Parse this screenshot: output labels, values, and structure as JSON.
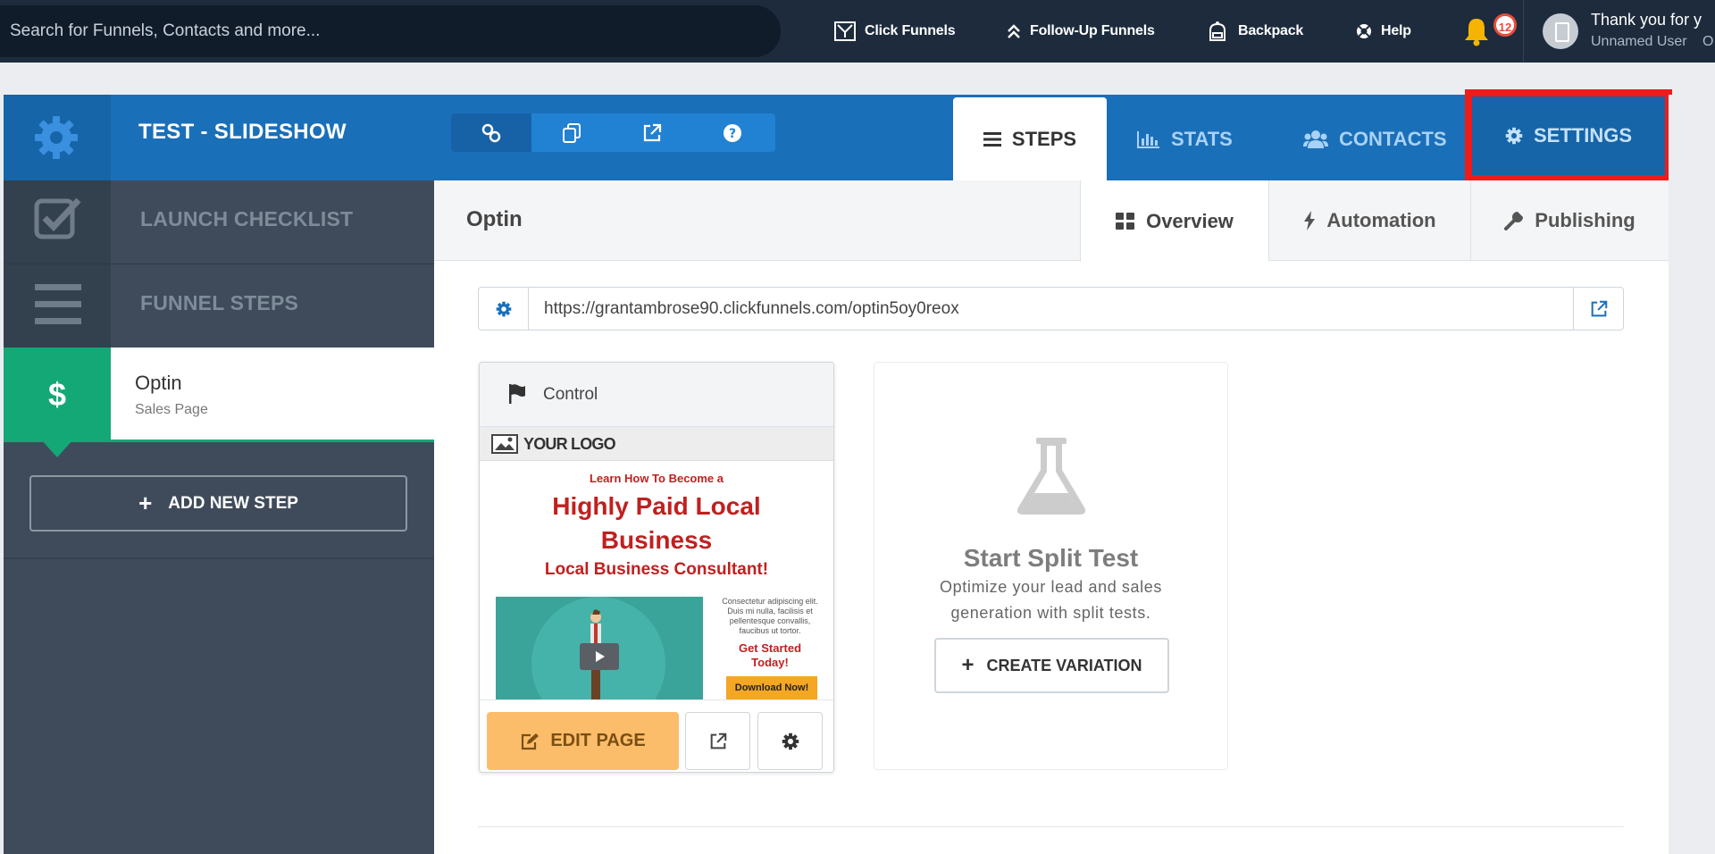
{
  "topbar": {
    "search_placeholder": "Search for Funnels, Contacts and more...",
    "nav": [
      {
        "label": "Click Funnels",
        "icon": "clickfunnels-icon"
      },
      {
        "label": "Follow-Up Funnels",
        "icon": "chevrons-up-icon"
      },
      {
        "label": "Backpack",
        "icon": "backpack-icon"
      },
      {
        "label": "Help",
        "icon": "lifebuoy-icon"
      }
    ],
    "notification_count": "12",
    "user_greeting": "Thank you for y",
    "user_name": "Unnamed User",
    "user_extra": "O"
  },
  "funnel": {
    "title": "TEST - SLIDESHOW",
    "tools": [
      "link-icon",
      "copy-icon",
      "external-link-icon",
      "question-icon"
    ],
    "tabs": {
      "steps": "STEPS",
      "stats": "STATS",
      "contacts": "CONTACTS",
      "settings": "SETTINGS"
    }
  },
  "sidebar": {
    "launch_checklist": "LAUNCH CHECKLIST",
    "funnel_steps": "FUNNEL STEPS",
    "active_step": {
      "symbol": "$",
      "name": "Optin",
      "type": "Sales Page"
    },
    "add_step": "ADD NEW STEP"
  },
  "step_panel": {
    "title": "Optin",
    "subtabs": {
      "overview": "Overview",
      "automation": "Automation",
      "publishing": "Publishing"
    },
    "url": "https://grantambrose90.clickfunnels.com/optin5oy0reox"
  },
  "control_card": {
    "label": "Control",
    "preview": {
      "logo": "YOUR LOGO",
      "kicker": "Learn How To Become a",
      "headline": "Highly Paid Local Business",
      "subhead": "Local Business Consultant!",
      "body": "Consectetur adipiscing elit. Duis mi nulla, facilisis et pellentesque convallis, faucibus ut tortor.",
      "cta_text": "Get Started Today!",
      "cta_button": "Download Now!"
    },
    "edit_button": "EDIT PAGE"
  },
  "split_test": {
    "title": "Start Split Test",
    "description": "Optimize your lead and sales generation with split tests.",
    "button": "CREATE VARIATION"
  },
  "colors": {
    "topbar": "#1d2b3d",
    "header_blue": "#1a6fb9",
    "sidebar": "#3f4b5a",
    "green": "#14a876",
    "highlight": "#ef1b1b",
    "edit_button": "#fbbd6a"
  }
}
